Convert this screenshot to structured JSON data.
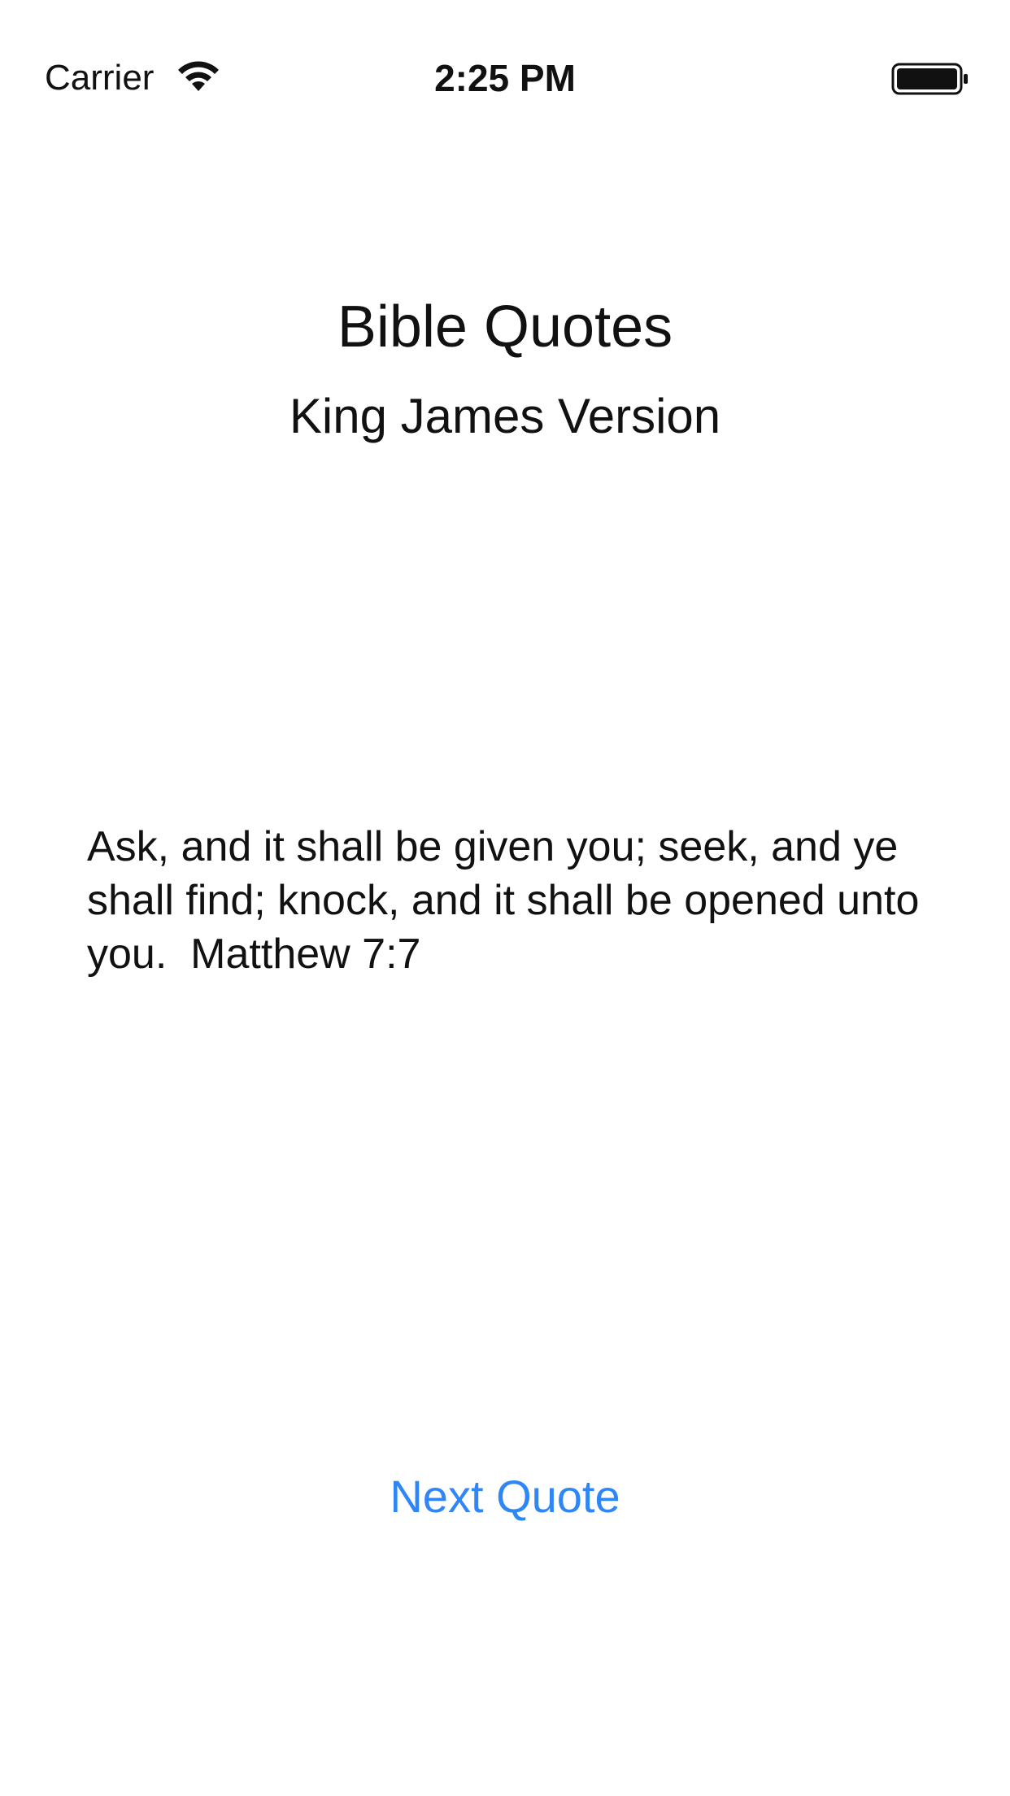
{
  "status_bar": {
    "carrier": "Carrier",
    "time": "2:25 PM",
    "wifi_icon": "wifi-icon",
    "battery_icon": "battery-icon"
  },
  "header": {
    "title": "Bible Quotes",
    "subtitle": "King James Version"
  },
  "quote": {
    "text": "Ask, and it shall be given you; seek, and ye shall find; knock, and it shall be opened unto you.  Matthew 7:7"
  },
  "actions": {
    "next_label": "Next Quote"
  },
  "colors": {
    "accent": "#2f86f6",
    "text": "#111111",
    "background": "#ffffff"
  }
}
